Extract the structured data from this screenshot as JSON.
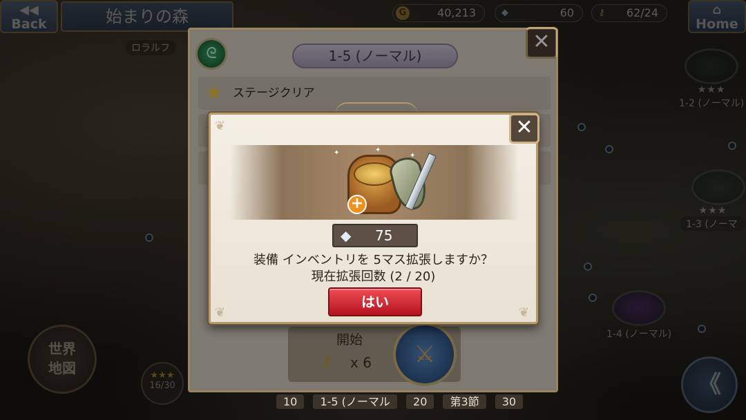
{
  "topbar": {
    "back_label": "Back",
    "back_glyph": "◀◀",
    "area_title": "始まりの森",
    "gold": "40,213",
    "gold_icon": "G",
    "gems": "60",
    "keys": "62/24",
    "home_label": "Home",
    "home_glyph": "⌂"
  },
  "map": {
    "nodes": [
      {
        "label": "1-2 (ノーマル)"
      },
      {
        "label": "1-3 (ノーマ"
      },
      {
        "label": "1-4 (ノーマル)"
      }
    ],
    "side_label": "ロラルフ",
    "world_map_label_1": "世界",
    "world_map_label_2": "地図",
    "progress": "16/30",
    "progress_stars": "★★★",
    "fast_forward_glyph": "《"
  },
  "stage_panel": {
    "title": "1-5 (ノーマル)",
    "mission_1": "ステージクリア",
    "start_label": "開始",
    "key_cost": "x 6",
    "stamina_left": "10",
    "stage_name_footer": "1-5 (ノーマル",
    "stamina_right": "20",
    "chapter_label": "第3節",
    "chapter_value": "30"
  },
  "dialog": {
    "close_glyph": "✕",
    "gem_cost": "75",
    "message_line_1": "装備 インベントリを 5マス拡張しますか？",
    "message_line_2": "現在拡張回数 (2 / 20)",
    "confirm_label": "はい"
  },
  "colors": {
    "confirm_button": "#d42a35",
    "dialog_bg": "#f1ebe1",
    "frame_gold": "#b49a6c"
  }
}
